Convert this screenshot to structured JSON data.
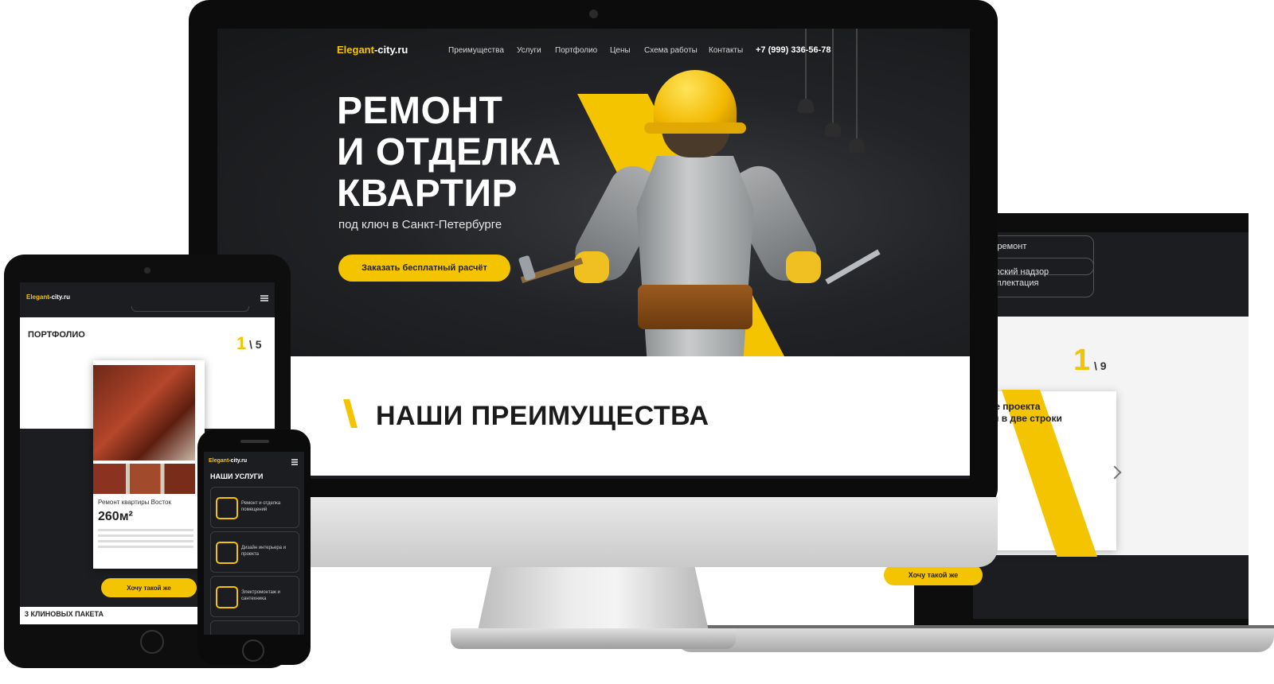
{
  "colors": {
    "accent": "#f5c400",
    "dark": "#1b1c1f",
    "white": "#ffffff"
  },
  "desktop": {
    "logo_main": "Elegant",
    "logo_rest": "-city.ru",
    "nav": [
      "Преимущества",
      "Услуги",
      "Портфолио",
      "Цены",
      "Схема работы",
      "Контакты"
    ],
    "phone": "+7 (999) 336-56-78",
    "hero": {
      "title_line1": "РЕМОНТ",
      "title_line2": "И ОТДЕЛКА",
      "title_line3": "КВАРТИР",
      "subtitle": "под ключ в Санкт-Петербурге",
      "cta": "Заказать бесплатный расчёт"
    },
    "section_title": "НАШИ ПРЕИМУЩЕСТВА"
  },
  "laptop": {
    "pill_1": "ий ремонт",
    "pill_2a": "вторский надзор",
    "pill_2b": "комплектация",
    "counter_current": "1",
    "counter_total": "\\ 9",
    "card_title_1": "ание проекта",
    "card_title_2": "щим в две строки",
    "cta": "Хочу такой же"
  },
  "tablet": {
    "logo_main": "Elegant",
    "logo_rest": "-city.ru",
    "section_title": "ПОРТФОЛИО",
    "counter_current": "1",
    "counter_total": "\\ 5",
    "caption": "Ремонт квартиры Восток",
    "price": "260м²",
    "cta": "Хочу такой же",
    "footer": "3 КЛИНОВЫХ ПАКЕТА"
  },
  "phone": {
    "logo_main": "Elegant",
    "logo_rest": "-city.ru",
    "section_title": "НАШИ УСЛУГИ",
    "services": [
      "Ремонт и отделка помещений",
      "Дизайн интерьера и проекта",
      "Электромонтаж и сантехника"
    ]
  }
}
